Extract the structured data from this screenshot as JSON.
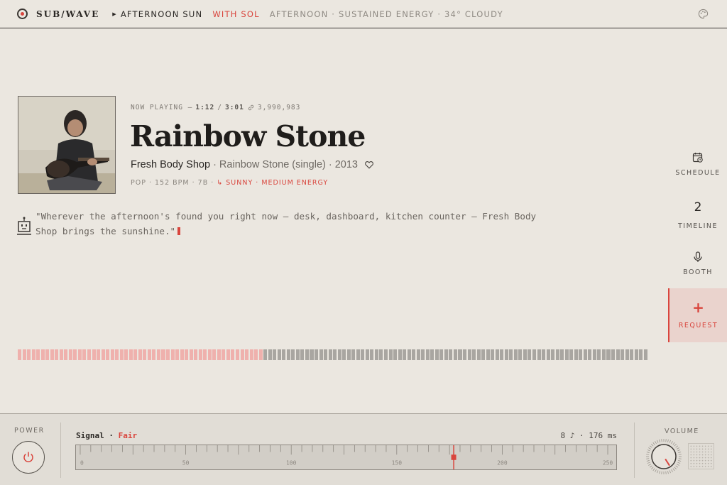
{
  "topbar": {
    "brand": "SUB/WAVE",
    "show": "AFTERNOON SUN",
    "host": "WITH SOL",
    "meta": "AFTERNOON · SUSTAINED ENERGY · 34° CLOUDY",
    "icons": {
      "logo": "record-logo-icon",
      "theme": "palette-icon"
    }
  },
  "now_playing": {
    "label": "NOW PLAYING —",
    "elapsed": "1:12",
    "separator": "/",
    "duration": "3:01",
    "plays": "3,990,983",
    "title": "Rainbow Stone",
    "artist": "Fresh Body Shop",
    "details": "· Rainbow Stone (single) · 2013",
    "tags": "POP · 152 BPM · 7B ·",
    "mood": "↳ SUNNY · MEDIUM ENERGY",
    "progress": 0.39
  },
  "dj_quote": "\"Wherever the afternoon's found you right now — desk, dashboard, kitchen counter — Fresh Body Shop brings the sunshine.\"",
  "rail": {
    "schedule": "SCHEDULE",
    "timeline_count": "2",
    "timeline": "TIMELINE",
    "booth": "BOOTH",
    "request_plus": "+",
    "request": "REQUEST"
  },
  "console": {
    "power_label": "POWER",
    "signal_label": "Signal ·",
    "signal_status": "Fair",
    "stats": "8 ♪ · 176 ms",
    "dial_labels": [
      "0",
      "50",
      "100",
      "150",
      "200",
      "250"
    ],
    "dial_min": 0,
    "dial_max": 250,
    "dial_value": 177,
    "volume_label": "VOLUME",
    "volume_level": 0.62
  },
  "colors": {
    "accent": "#d9453d",
    "background": "#ebe7e0",
    "console": "#e1ddd6",
    "progress_on": "#efb1ad",
    "progress_off": "#a9a6a1"
  }
}
